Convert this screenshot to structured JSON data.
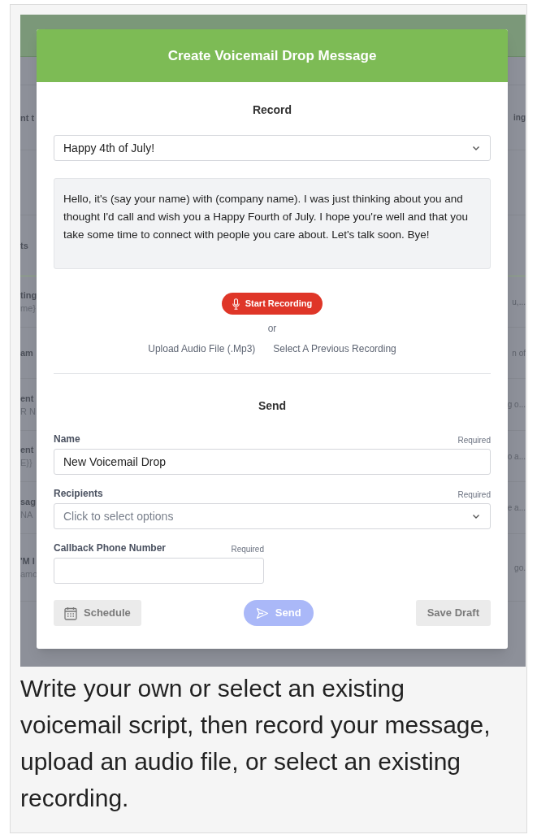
{
  "background": {
    "rows": [
      {
        "left": "",
        "right": ""
      },
      {
        "left": "nt t",
        "right": "ing"
      },
      {
        "left": "",
        "right": ""
      },
      {
        "left": "ts",
        "right": ""
      },
      {
        "left": "ting",
        "left_sub": "me}",
        "right": "u,..."
      },
      {
        "left": "am",
        "right": "n of"
      },
      {
        "left": "ent",
        "left_sub": "R N",
        "right": "g o..."
      },
      {
        "left": "ent",
        "left_sub": "E}}",
        "right": "o a..."
      },
      {
        "left": "sag",
        "left_sub": "NA",
        "right": "e a..."
      },
      {
        "left": "'M I",
        "left_sub": "amo",
        "right": "go."
      }
    ]
  },
  "modal": {
    "title": "Create Voicemail Drop Message",
    "record": {
      "heading": "Record",
      "script_select": "Happy 4th of July!",
      "script_text": "Hello, it's (say your name) with (company name). I was just thinking about you and thought I'd call and wish you a Happy Fourth of July. I hope you're well and that you take some time to connect with people you care about. Let's talk soon. Bye!",
      "record_button": "Start Recording",
      "or": "or",
      "links": [
        "Upload Audio File (.Mp3)",
        "Select A Previous Recording"
      ]
    },
    "send": {
      "heading": "Send",
      "fields": [
        {
          "kind": "text",
          "label": "Name",
          "required": "Required",
          "value": "New Voicemail Drop"
        },
        {
          "kind": "select",
          "label": "Recipients",
          "required": "Required",
          "placeholder": "Click to select options"
        },
        {
          "kind": "short",
          "label": "Callback Phone Number",
          "required": "Required"
        }
      ]
    },
    "buttons": [
      {
        "kind": "schedule",
        "label": "Schedule",
        "disabled": false
      },
      {
        "kind": "send",
        "label": "Send",
        "disabled": true
      },
      {
        "kind": "draft",
        "label": "Save Draft",
        "disabled": false
      }
    ]
  },
  "caption": "Write your own or select an existing voicemail script, then record your message, upload an audio file, or select an existing recording."
}
